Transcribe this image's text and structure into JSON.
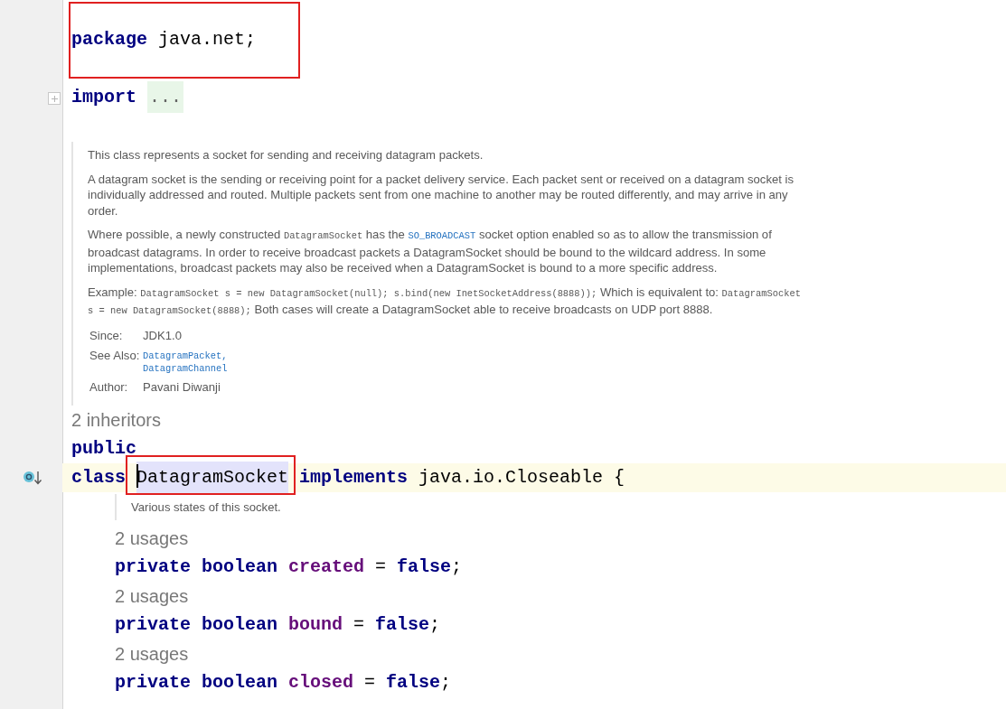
{
  "lines": [
    {
      "kind": "code",
      "annotated": true,
      "tokens": [
        {
          "text": "package",
          "kind": "keyword"
        },
        {
          "text": " java.net;",
          "kind": "plain"
        }
      ]
    },
    {
      "kind": "blank"
    },
    {
      "kind": "code",
      "folded": true,
      "tokens": [
        {
          "text": "import ",
          "kind": "keyword"
        },
        {
          "text": "...",
          "kind": "fold"
        }
      ]
    },
    {
      "kind": "blank"
    },
    {
      "kind": "doc",
      "paragraphs": [
        [
          {
            "text": "This class represents a socket for sending and receiving datagram packets.",
            "kind": "text"
          }
        ],
        [
          {
            "text": "A datagram socket is the sending or receiving point for a packet delivery service. Each packet sent or received on a datagram socket is individually addressed and routed. Multiple packets sent from one machine to another may be routed differently, and may arrive in any order.",
            "kind": "text"
          }
        ],
        [
          {
            "text": "Where possible, a newly constructed ",
            "kind": "text"
          },
          {
            "text": "DatagramSocket",
            "kind": "code"
          },
          {
            "text": " has the ",
            "kind": "text"
          },
          {
            "text": "SO_BROADCAST",
            "kind": "link"
          },
          {
            "text": " socket option enabled so as to allow the transmission of broadcast datagrams. In order to receive broadcast packets a DatagramSocket should be bound to the wildcard address. In some implementations, broadcast packets may also be received when a DatagramSocket is bound to a more specific address.",
            "kind": "text"
          }
        ],
        [
          {
            "text": "Example: ",
            "kind": "text"
          },
          {
            "text": "DatagramSocket s = new DatagramSocket(null); s.bind(new InetSocketAddress(8888));",
            "kind": "code"
          },
          {
            "text": " Which is equivalent to: ",
            "kind": "text"
          },
          {
            "text": "DatagramSocket s = new DatagramSocket(8888);",
            "kind": "code"
          },
          {
            "text": " Both cases will create a DatagramSocket able to receive broadcasts on UDP port 8888.",
            "kind": "text"
          }
        ]
      ],
      "tags": [
        {
          "label": "Since:",
          "values": [
            {
              "text": "JDK1.0",
              "kind": "text"
            }
          ]
        },
        {
          "label": "See Also:",
          "values": [
            {
              "text": "DatagramPacket,",
              "kind": "link"
            },
            {
              "text": "DatagramChannel",
              "kind": "link"
            }
          ]
        },
        {
          "label": "Author:",
          "values": [
            {
              "text": "Pavani Diwanji",
              "kind": "text"
            }
          ]
        }
      ]
    },
    {
      "kind": "hint",
      "text": "2 inheritors"
    },
    {
      "kind": "code",
      "tokens": [
        {
          "text": "public",
          "kind": "keyword"
        }
      ]
    },
    {
      "kind": "code",
      "current": true,
      "marked": true,
      "tokens": [
        {
          "text": "class ",
          "kind": "keyword"
        },
        {
          "text": "DatagramSocket",
          "kind": "plain",
          "highlight": true,
          "caret": true,
          "annotated": true
        },
        {
          "text": " implements",
          "kind": "keyword"
        },
        {
          "text": " java.io.Closeable {",
          "kind": "plain"
        }
      ]
    },
    {
      "kind": "doc",
      "indent": true,
      "paragraphs": [
        [
          {
            "text": "Various states of this socket.",
            "kind": "text"
          }
        ]
      ]
    },
    {
      "kind": "hint",
      "indent": true,
      "text": "2 usages"
    },
    {
      "kind": "code",
      "indent": true,
      "tokens": [
        {
          "text": "private",
          "kind": "keyword"
        },
        {
          "text": " boolean",
          "kind": "keyword"
        },
        {
          "text": " created",
          "kind": "field"
        },
        {
          "text": " = ",
          "kind": "plain"
        },
        {
          "text": "false",
          "kind": "keyword"
        },
        {
          "text": ";",
          "kind": "plain"
        }
      ]
    },
    {
      "kind": "hint",
      "indent": true,
      "text": "2 usages"
    },
    {
      "kind": "code",
      "indent": true,
      "tokens": [
        {
          "text": "private",
          "kind": "keyword"
        },
        {
          "text": " boolean",
          "kind": "keyword"
        },
        {
          "text": " bound",
          "kind": "field"
        },
        {
          "text": " = ",
          "kind": "plain"
        },
        {
          "text": "false",
          "kind": "keyword"
        },
        {
          "text": ";",
          "kind": "plain"
        }
      ]
    },
    {
      "kind": "hint",
      "indent": true,
      "text": "2 usages"
    },
    {
      "kind": "code",
      "indent": true,
      "tokens": [
        {
          "text": "private",
          "kind": "keyword"
        },
        {
          "text": " boolean",
          "kind": "keyword"
        },
        {
          "text": " closed",
          "kind": "field"
        },
        {
          "text": " = ",
          "kind": "plain"
        },
        {
          "text": "false",
          "kind": "keyword"
        },
        {
          "text": ";",
          "kind": "plain"
        }
      ]
    }
  ]
}
